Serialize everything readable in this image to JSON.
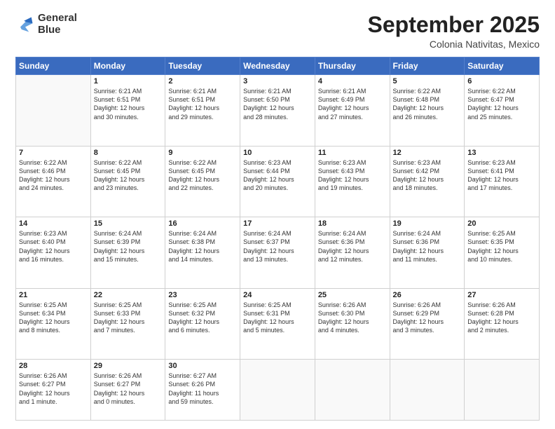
{
  "logo": {
    "line1": "General",
    "line2": "Blue"
  },
  "title": "September 2025",
  "subtitle": "Colonia Nativitas, Mexico",
  "days_of_week": [
    "Sunday",
    "Monday",
    "Tuesday",
    "Wednesday",
    "Thursday",
    "Friday",
    "Saturday"
  ],
  "weeks": [
    [
      {
        "num": "",
        "info": ""
      },
      {
        "num": "1",
        "info": "Sunrise: 6:21 AM\nSunset: 6:51 PM\nDaylight: 12 hours\nand 30 minutes."
      },
      {
        "num": "2",
        "info": "Sunrise: 6:21 AM\nSunset: 6:51 PM\nDaylight: 12 hours\nand 29 minutes."
      },
      {
        "num": "3",
        "info": "Sunrise: 6:21 AM\nSunset: 6:50 PM\nDaylight: 12 hours\nand 28 minutes."
      },
      {
        "num": "4",
        "info": "Sunrise: 6:21 AM\nSunset: 6:49 PM\nDaylight: 12 hours\nand 27 minutes."
      },
      {
        "num": "5",
        "info": "Sunrise: 6:22 AM\nSunset: 6:48 PM\nDaylight: 12 hours\nand 26 minutes."
      },
      {
        "num": "6",
        "info": "Sunrise: 6:22 AM\nSunset: 6:47 PM\nDaylight: 12 hours\nand 25 minutes."
      }
    ],
    [
      {
        "num": "7",
        "info": "Sunrise: 6:22 AM\nSunset: 6:46 PM\nDaylight: 12 hours\nand 24 minutes."
      },
      {
        "num": "8",
        "info": "Sunrise: 6:22 AM\nSunset: 6:45 PM\nDaylight: 12 hours\nand 23 minutes."
      },
      {
        "num": "9",
        "info": "Sunrise: 6:22 AM\nSunset: 6:45 PM\nDaylight: 12 hours\nand 22 minutes."
      },
      {
        "num": "10",
        "info": "Sunrise: 6:23 AM\nSunset: 6:44 PM\nDaylight: 12 hours\nand 20 minutes."
      },
      {
        "num": "11",
        "info": "Sunrise: 6:23 AM\nSunset: 6:43 PM\nDaylight: 12 hours\nand 19 minutes."
      },
      {
        "num": "12",
        "info": "Sunrise: 6:23 AM\nSunset: 6:42 PM\nDaylight: 12 hours\nand 18 minutes."
      },
      {
        "num": "13",
        "info": "Sunrise: 6:23 AM\nSunset: 6:41 PM\nDaylight: 12 hours\nand 17 minutes."
      }
    ],
    [
      {
        "num": "14",
        "info": "Sunrise: 6:23 AM\nSunset: 6:40 PM\nDaylight: 12 hours\nand 16 minutes."
      },
      {
        "num": "15",
        "info": "Sunrise: 6:24 AM\nSunset: 6:39 PM\nDaylight: 12 hours\nand 15 minutes."
      },
      {
        "num": "16",
        "info": "Sunrise: 6:24 AM\nSunset: 6:38 PM\nDaylight: 12 hours\nand 14 minutes."
      },
      {
        "num": "17",
        "info": "Sunrise: 6:24 AM\nSunset: 6:37 PM\nDaylight: 12 hours\nand 13 minutes."
      },
      {
        "num": "18",
        "info": "Sunrise: 6:24 AM\nSunset: 6:36 PM\nDaylight: 12 hours\nand 12 minutes."
      },
      {
        "num": "19",
        "info": "Sunrise: 6:24 AM\nSunset: 6:36 PM\nDaylight: 12 hours\nand 11 minutes."
      },
      {
        "num": "20",
        "info": "Sunrise: 6:25 AM\nSunset: 6:35 PM\nDaylight: 12 hours\nand 10 minutes."
      }
    ],
    [
      {
        "num": "21",
        "info": "Sunrise: 6:25 AM\nSunset: 6:34 PM\nDaylight: 12 hours\nand 8 minutes."
      },
      {
        "num": "22",
        "info": "Sunrise: 6:25 AM\nSunset: 6:33 PM\nDaylight: 12 hours\nand 7 minutes."
      },
      {
        "num": "23",
        "info": "Sunrise: 6:25 AM\nSunset: 6:32 PM\nDaylight: 12 hours\nand 6 minutes."
      },
      {
        "num": "24",
        "info": "Sunrise: 6:25 AM\nSunset: 6:31 PM\nDaylight: 12 hours\nand 5 minutes."
      },
      {
        "num": "25",
        "info": "Sunrise: 6:26 AM\nSunset: 6:30 PM\nDaylight: 12 hours\nand 4 minutes."
      },
      {
        "num": "26",
        "info": "Sunrise: 6:26 AM\nSunset: 6:29 PM\nDaylight: 12 hours\nand 3 minutes."
      },
      {
        "num": "27",
        "info": "Sunrise: 6:26 AM\nSunset: 6:28 PM\nDaylight: 12 hours\nand 2 minutes."
      }
    ],
    [
      {
        "num": "28",
        "info": "Sunrise: 6:26 AM\nSunset: 6:27 PM\nDaylight: 12 hours\nand 1 minute."
      },
      {
        "num": "29",
        "info": "Sunrise: 6:26 AM\nSunset: 6:27 PM\nDaylight: 12 hours\nand 0 minutes."
      },
      {
        "num": "30",
        "info": "Sunrise: 6:27 AM\nSunset: 6:26 PM\nDaylight: 11 hours\nand 59 minutes."
      },
      {
        "num": "",
        "info": ""
      },
      {
        "num": "",
        "info": ""
      },
      {
        "num": "",
        "info": ""
      },
      {
        "num": "",
        "info": ""
      }
    ]
  ]
}
